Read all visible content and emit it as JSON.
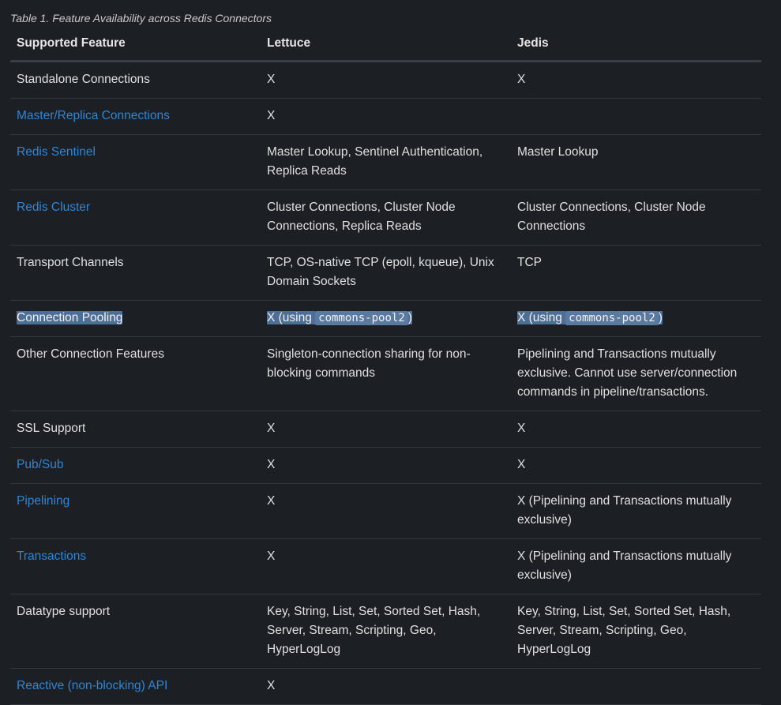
{
  "caption": "Table 1. Feature Availability across Redis Connectors",
  "headers": [
    "Supported Feature",
    "Lettuce",
    "Jedis"
  ],
  "rows": [
    {
      "feature": "Standalone Connections",
      "link": false,
      "lettuce": "X",
      "jedis": "X"
    },
    {
      "feature": "Master/Replica Connections",
      "link": true,
      "lettuce": "X",
      "jedis": ""
    },
    {
      "feature": "Redis Sentinel",
      "link": true,
      "lettuce": "Master Lookup, Sentinel Authentication, Replica Reads",
      "jedis": "Master Lookup"
    },
    {
      "feature": "Redis Cluster",
      "link": true,
      "lettuce": "Cluster Connections, Cluster Node Connections, Replica Reads",
      "jedis": "Cluster Connections, Cluster Node Connections"
    },
    {
      "feature": "Transport Channels",
      "link": false,
      "lettuce": "TCP, OS-native TCP (epoll, kqueue), Unix Domain Sockets",
      "jedis": "TCP"
    },
    {
      "feature": "Connection Pooling",
      "link": false,
      "lettuce_prefix": "X (using ",
      "lettuce_code": "commons-pool2",
      "lettuce_suffix": ")",
      "jedis_prefix": "X (using ",
      "jedis_code": "commons-pool2",
      "jedis_suffix": ")"
    },
    {
      "feature": "Other Connection Features",
      "link": false,
      "lettuce": "Singleton-connection sharing for non-blocking commands",
      "jedis": "Pipelining and Transactions mutually exclusive. Cannot use server/connection commands in pipeline/transactions."
    },
    {
      "feature": "SSL Support",
      "link": false,
      "lettuce": "X",
      "jedis": "X"
    },
    {
      "feature": "Pub/Sub",
      "link": true,
      "lettuce": "X",
      "jedis": "X"
    },
    {
      "feature": "Pipelining",
      "link": true,
      "lettuce": "X",
      "jedis": "X (Pipelining and Transactions mutually exclusive)"
    },
    {
      "feature": "Transactions",
      "link": true,
      "lettuce": "X",
      "jedis": "X (Pipelining and Transactions mutually exclusive)"
    },
    {
      "feature": "Datatype support",
      "link": false,
      "lettuce": "Key, String, List, Set, Sorted Set, Hash, Server, Stream, Scripting, Geo, HyperLogLog",
      "jedis": "Key, String, List, Set, Sorted Set, Hash, Server, Stream, Scripting, Geo, HyperLogLog"
    },
    {
      "feature": "Reactive (non-blocking) API",
      "link": true,
      "lettuce": "X",
      "jedis": ""
    }
  ]
}
